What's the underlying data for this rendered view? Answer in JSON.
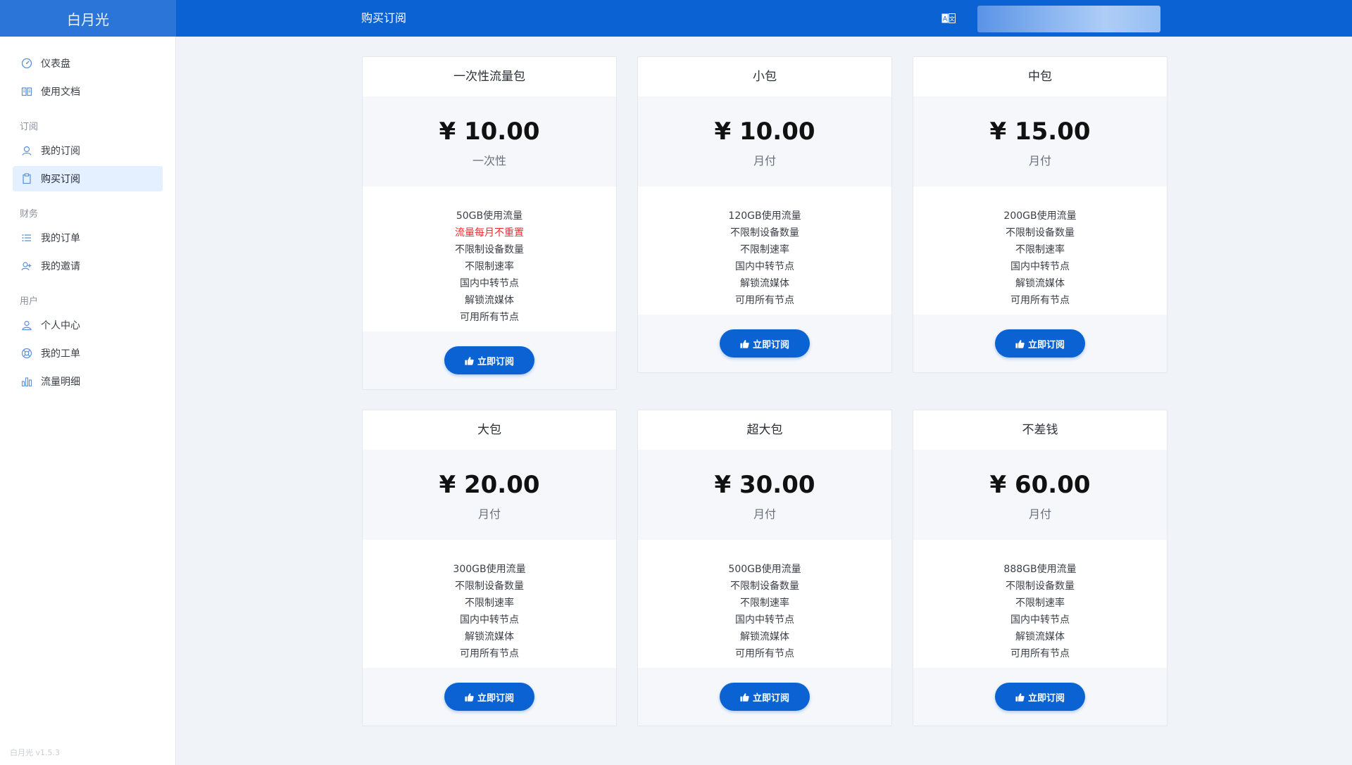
{
  "app": {
    "brand": "白月光",
    "version": "白月光 v1.5.3"
  },
  "header": {
    "title": "购买订阅",
    "lang_icon": "translate-icon"
  },
  "sidebar": {
    "top_items": [
      {
        "label": "仪表盘",
        "icon": "dashboard-icon"
      },
      {
        "label": "使用文档",
        "icon": "book-icon"
      }
    ],
    "sections": [
      {
        "title": "订阅",
        "items": [
          {
            "label": "我的订阅",
            "icon": "user-badge-icon"
          },
          {
            "label": "购买订阅",
            "icon": "clipboard-icon",
            "active": true
          }
        ]
      },
      {
        "title": "财务",
        "items": [
          {
            "label": "我的订单",
            "icon": "list-icon"
          },
          {
            "label": "我的邀请",
            "icon": "invite-icon"
          }
        ]
      },
      {
        "title": "用户",
        "items": [
          {
            "label": "个人中心",
            "icon": "person-icon"
          },
          {
            "label": "我的工单",
            "icon": "support-icon"
          },
          {
            "label": "流量明细",
            "icon": "bar-chart-icon"
          }
        ]
      }
    ]
  },
  "plans": [
    {
      "name": "一次性流量包",
      "price": "¥ 10.00",
      "period": "一次性",
      "features": [
        "50GB使用流量",
        "流量每月不重置",
        "不限制设备数量",
        "不限制速率",
        "国内中转节点",
        "解锁流媒体",
        "可用所有节点"
      ],
      "highlight_index": 1,
      "button": "立即订阅"
    },
    {
      "name": "小包",
      "price": "¥ 10.00",
      "period": "月付",
      "features": [
        "120GB使用流量",
        "不限制设备数量",
        "不限制速率",
        "国内中转节点",
        "解锁流媒体",
        "可用所有节点"
      ],
      "button": "立即订阅"
    },
    {
      "name": "中包",
      "price": "¥ 15.00",
      "period": "月付",
      "features": [
        "200GB使用流量",
        "不限制设备数量",
        "不限制速率",
        "国内中转节点",
        "解锁流媒体",
        "可用所有节点"
      ],
      "button": "立即订阅"
    },
    {
      "name": "大包",
      "price": "¥ 20.00",
      "period": "月付",
      "features": [
        "300GB使用流量",
        "不限制设备数量",
        "不限制速率",
        "国内中转节点",
        "解锁流媒体",
        "可用所有节点"
      ],
      "button": "立即订阅"
    },
    {
      "name": "超大包",
      "price": "¥ 30.00",
      "period": "月付",
      "features": [
        "500GB使用流量",
        "不限制设备数量",
        "不限制速率",
        "国内中转节点",
        "解锁流媒体",
        "可用所有节点"
      ],
      "button": "立即订阅"
    },
    {
      "name": "不差钱",
      "price": "¥ 60.00",
      "period": "月付",
      "features": [
        "888GB使用流量",
        "不限制设备数量",
        "不限制速率",
        "国内中转节点",
        "解锁流媒体",
        "可用所有节点"
      ],
      "button": "立即订阅"
    }
  ],
  "colors": {
    "primary": "#0b62d2",
    "highlight": "#f2292e",
    "active_bg": "#e4efff"
  }
}
